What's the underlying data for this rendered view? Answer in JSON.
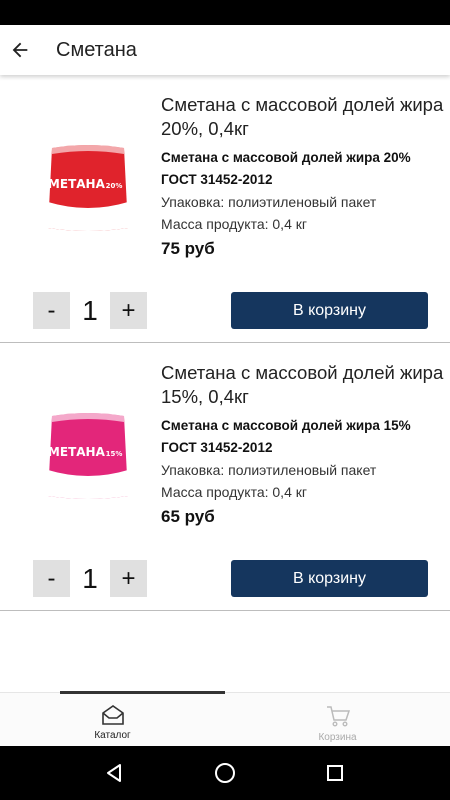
{
  "header": {
    "title": "Сметана"
  },
  "products": [
    {
      "title": "Сметана с массовой долей жира 20%, 0,4кг",
      "subtitle": "Сметана с массовой долей жира 20%",
      "gost": "ГОСТ 31452-2012",
      "packaging": "Упаковка: полиэтиленовый пакет",
      "weight": "Масса продукта: 0,4 кг",
      "price": "75 руб",
      "quantity": "1",
      "minus_label": "-",
      "plus_label": "+",
      "cart_label": "В корзину",
      "pack_brand": "СМЕТАНА",
      "pack_fat": "20%",
      "pack_color": "#e0232c"
    },
    {
      "title": "Сметана с массовой долей жира 15%, 0,4кг",
      "subtitle": "Сметана с массовой долей жира 15%",
      "gost": "ГОСТ 31452-2012",
      "packaging": "Упаковка: полиэтиленовый пакет",
      "weight": "Масса продукта: 0,4 кг",
      "price": "65 руб",
      "quantity": "1",
      "minus_label": "-",
      "plus_label": "+",
      "cart_label": "В корзину",
      "pack_brand": "СМЕТАНА",
      "pack_fat": "15%",
      "pack_color": "#e3267a"
    }
  ],
  "bottom_nav": {
    "items": [
      {
        "label": "Каталог",
        "icon": "catalog-icon",
        "active": true
      },
      {
        "label": "Корзина",
        "icon": "cart-icon",
        "active": false
      }
    ]
  },
  "system_nav": {
    "icons": [
      "back-triangle-icon",
      "home-circle-icon",
      "recents-square-icon"
    ]
  },
  "colors": {
    "accent": "#15365e",
    "qty_bg": "#e0e0e0"
  }
}
